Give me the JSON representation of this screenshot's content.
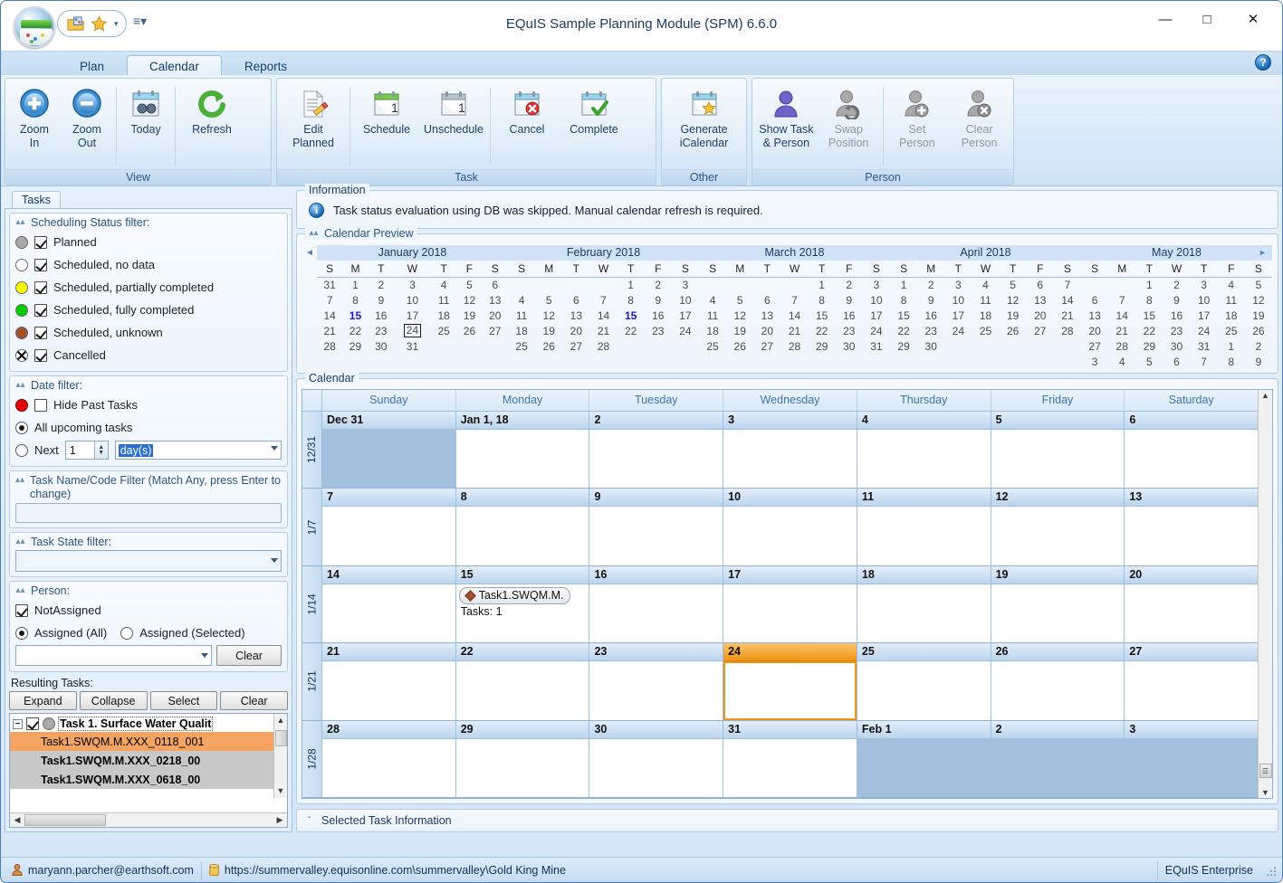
{
  "window": {
    "title": "EQuIS Sample Planning Module (SPM) 6.6.0",
    "minimize": "—",
    "maximize": "☐",
    "close": "✕",
    "qat_dropdown": "▾",
    "qat_overflow": "‰"
  },
  "ribbon": {
    "tabs": [
      {
        "label": "Plan",
        "active": false
      },
      {
        "label": "Calendar",
        "active": true
      },
      {
        "label": "Reports",
        "active": false
      }
    ],
    "help_label": "?",
    "groups": [
      {
        "name": "View",
        "label": "View",
        "buttons": [
          {
            "label": "Zoom\nIn",
            "line1": "Zoom",
            "line2": "In",
            "icon": "zoom-in-icon",
            "disabled": false
          },
          {
            "label": "Zoom Out",
            "line1": "Zoom",
            "line2": "Out",
            "icon": "zoom-out-icon",
            "disabled": false
          },
          {
            "label": "Today",
            "line1": "Today",
            "line2": "",
            "icon": "today-icon",
            "disabled": false
          },
          {
            "label": "Refresh",
            "line1": "Refresh",
            "line2": "",
            "icon": "refresh-icon",
            "disabled": false
          }
        ]
      },
      {
        "name": "Task",
        "label": "Task",
        "buttons": [
          {
            "line1": "Edit",
            "line2": "Planned",
            "icon": "edit-planned-icon",
            "disabled": false
          },
          {
            "line1": "Schedule",
            "line2": "",
            "icon": "schedule-icon",
            "disabled": false
          },
          {
            "line1": "Unschedule",
            "line2": "",
            "icon": "unschedule-icon",
            "disabled": false
          },
          {
            "line1": "Cancel",
            "line2": "",
            "icon": "cancel-icon",
            "disabled": false
          },
          {
            "line1": "Complete",
            "line2": "",
            "icon": "complete-icon",
            "disabled": false
          }
        ]
      },
      {
        "name": "Other",
        "label": "Other",
        "buttons": [
          {
            "line1": "Generate",
            "line2": "iCalendar",
            "icon": "generate-icalendar-icon",
            "disabled": false
          }
        ]
      },
      {
        "name": "Person",
        "label": "Person",
        "buttons": [
          {
            "line1": "Show Task",
            "line2": "& Person",
            "icon": "show-task-person-icon",
            "disabled": false
          },
          {
            "line1": "Swap",
            "line2": "Position",
            "icon": "swap-position-icon",
            "disabled": true
          },
          {
            "line1": "Set",
            "line2": "Person",
            "icon": "set-person-icon",
            "disabled": true
          },
          {
            "line1": "Clear",
            "line2": "Person",
            "icon": "clear-person-icon",
            "disabled": true
          }
        ]
      }
    ]
  },
  "left": {
    "tab_label": "Tasks",
    "scheduling_status": {
      "title": "Scheduling Status filter:",
      "items": [
        {
          "label": "Planned",
          "color": "#a9a9a9",
          "checked": true
        },
        {
          "label": "Scheduled, no data",
          "color": "#ffffff",
          "checked": true
        },
        {
          "label": "Scheduled, partially completed",
          "color": "#ffff00",
          "checked": true
        },
        {
          "label": "Scheduled, fully completed",
          "color": "#00cc00",
          "checked": true
        },
        {
          "label": "Scheduled, unknown",
          "color": "#a0522d",
          "checked": true
        },
        {
          "label": "Cancelled",
          "color": "#ffffff",
          "checked": true,
          "marker": "x"
        }
      ]
    },
    "date_filter": {
      "title": "Date filter:",
      "hide_past_label": "Hide Past Tasks",
      "hide_past_checked": false,
      "hide_past_color": "#e00000",
      "all_upcoming_label": "All upcoming tasks",
      "all_upcoming_selected": true,
      "next_label": "Next",
      "next_selected": false,
      "next_value": "1",
      "next_unit": "day(s)"
    },
    "name_filter": {
      "title": "Task Name/Code Filter (Match Any, press Enter to change)",
      "value": "",
      "placeholder": ""
    },
    "state_filter": {
      "title": "Task State filter:",
      "value": ""
    },
    "person": {
      "title": "Person:",
      "not_assigned_label": "NotAssigned",
      "not_assigned_checked": true,
      "assigned_all_label": "Assigned (All)",
      "assigned_all_selected": true,
      "assigned_selected_label": "Assigned (Selected)",
      "assigned_selected_selected": false,
      "combo_value": "",
      "clear_label": "Clear"
    },
    "results": {
      "title": "Resulting Tasks:",
      "buttons": [
        "Expand",
        "Collapse",
        "Select",
        "Clear"
      ],
      "root": {
        "label": "Task 1. Surface Water Qualit",
        "expander": "−",
        "checked": true,
        "color": "#a9a9a9"
      },
      "children": [
        {
          "label": "Task1.SWQM.M.XXX_0118_001",
          "state": "selected"
        },
        {
          "label": "Task1.SWQM.M.XXX_0218_00",
          "state": "grey"
        },
        {
          "label": "Task1.SWQM.M.XXX_0618_00",
          "state": "grey"
        }
      ]
    }
  },
  "information": {
    "legend": "Information",
    "message": "Task status evaluation using DB was skipped.  Manual calendar refresh is required."
  },
  "calendar_preview": {
    "legend": "Calendar Preview",
    "prev_arrow": "◄",
    "next_arrow": "►",
    "weekday_initials": [
      "S",
      "M",
      "T",
      "W",
      "T",
      "F",
      "S"
    ],
    "months": [
      {
        "title": "January 2018",
        "weeks": [
          [
            "31",
            "1",
            "2",
            "3",
            "4",
            "5",
            "6"
          ],
          [
            "7",
            "8",
            "9",
            "10",
            "11",
            "12",
            "13"
          ],
          [
            "14",
            "15",
            "16",
            "17",
            "18",
            "19",
            "20"
          ],
          [
            "21",
            "22",
            "23",
            "24",
            "25",
            "26",
            "27"
          ],
          [
            "28",
            "29",
            "30",
            "31",
            "",
            "",
            ""
          ],
          [
            "",
            "",
            "",
            "",
            "",
            "",
            ""
          ]
        ],
        "blue": [
          "15"
        ],
        "boxed": [
          "24"
        ]
      },
      {
        "title": "February 2018",
        "weeks": [
          [
            "",
            "",
            "",
            "",
            "1",
            "2",
            "3"
          ],
          [
            "4",
            "5",
            "6",
            "7",
            "8",
            "9",
            "10"
          ],
          [
            "11",
            "12",
            "13",
            "14",
            "15",
            "16",
            "17"
          ],
          [
            "18",
            "19",
            "20",
            "21",
            "22",
            "23",
            "24"
          ],
          [
            "25",
            "26",
            "27",
            "28",
            "",
            "",
            ""
          ],
          [
            "",
            "",
            "",
            "",
            "",
            "",
            ""
          ]
        ],
        "blue": [
          "15"
        ],
        "boxed": []
      },
      {
        "title": "March 2018",
        "weeks": [
          [
            "",
            "",
            "",
            "",
            "1",
            "2",
            "3"
          ],
          [
            "4",
            "5",
            "6",
            "7",
            "8",
            "9",
            "10"
          ],
          [
            "11",
            "12",
            "13",
            "14",
            "15",
            "16",
            "17"
          ],
          [
            "18",
            "19",
            "20",
            "21",
            "22",
            "23",
            "24"
          ],
          [
            "25",
            "26",
            "27",
            "28",
            "29",
            "30",
            "31"
          ],
          [
            "",
            "",
            "",
            "",
            "",
            "",
            ""
          ]
        ],
        "blue": [],
        "boxed": []
      },
      {
        "title": "April 2018",
        "weeks": [
          [
            "1",
            "2",
            "3",
            "4",
            "5",
            "6",
            "7"
          ],
          [
            "8",
            "9",
            "10",
            "11",
            "12",
            "13",
            "14"
          ],
          [
            "15",
            "16",
            "17",
            "18",
            "19",
            "20",
            "21"
          ],
          [
            "22",
            "23",
            "24",
            "25",
            "26",
            "27",
            "28"
          ],
          [
            "29",
            "30",
            "",
            "",
            "",
            "",
            ""
          ],
          [
            "",
            "",
            "",
            "",
            "",
            "",
            ""
          ]
        ],
        "blue": [],
        "boxed": []
      },
      {
        "title": "May 2018",
        "weeks": [
          [
            "",
            "",
            "1",
            "2",
            "3",
            "4",
            "5"
          ],
          [
            "6",
            "7",
            "8",
            "9",
            "10",
            "11",
            "12"
          ],
          [
            "13",
            "14",
            "15",
            "16",
            "17",
            "18",
            "19"
          ],
          [
            "20",
            "21",
            "22",
            "23",
            "24",
            "25",
            "26"
          ],
          [
            "27",
            "28",
            "29",
            "30",
            "31",
            "1",
            "2"
          ],
          [
            "3",
            "4",
            "5",
            "6",
            "7",
            "8",
            "9"
          ]
        ],
        "blue": [],
        "boxed": []
      }
    ]
  },
  "calendar": {
    "legend": "Calendar",
    "columns": [
      "Sunday",
      "Monday",
      "Tuesday",
      "Wednesday",
      "Thursday",
      "Friday",
      "Saturday"
    ],
    "scroll_up": "▲",
    "scroll_down": "▼",
    "weeks": [
      {
        "gutter": "12/31",
        "days": [
          {
            "num": "Dec 31",
            "other": true,
            "tasks": [],
            "count": "",
            "selected": false
          },
          {
            "num": "Jan 1, 18",
            "other": false,
            "tasks": [],
            "count": "",
            "selected": false
          },
          {
            "num": "2",
            "other": false,
            "tasks": [],
            "count": "",
            "selected": false
          },
          {
            "num": "3",
            "other": false,
            "tasks": [],
            "count": "",
            "selected": false
          },
          {
            "num": "4",
            "other": false,
            "tasks": [],
            "count": "",
            "selected": false
          },
          {
            "num": "5",
            "other": false,
            "tasks": [],
            "count": "",
            "selected": false
          },
          {
            "num": "6",
            "other": false,
            "tasks": [],
            "count": "",
            "selected": false
          }
        ]
      },
      {
        "gutter": "1/7",
        "days": [
          {
            "num": "7",
            "other": false,
            "tasks": [],
            "count": "",
            "selected": false
          },
          {
            "num": "8",
            "other": false,
            "tasks": [],
            "count": "",
            "selected": false
          },
          {
            "num": "9",
            "other": false,
            "tasks": [],
            "count": "",
            "selected": false
          },
          {
            "num": "10",
            "other": false,
            "tasks": [],
            "count": "",
            "selected": false
          },
          {
            "num": "11",
            "other": false,
            "tasks": [],
            "count": "",
            "selected": false
          },
          {
            "num": "12",
            "other": false,
            "tasks": [],
            "count": "",
            "selected": false
          },
          {
            "num": "13",
            "other": false,
            "tasks": [],
            "count": "",
            "selected": false
          }
        ]
      },
      {
        "gutter": "1/14",
        "days": [
          {
            "num": "14",
            "other": false,
            "tasks": [],
            "count": "",
            "selected": false
          },
          {
            "num": "15",
            "other": false,
            "tasks": [
              {
                "label": "Task1.SWQM.M.",
                "color": "#a0522d"
              }
            ],
            "count": "Tasks: 1",
            "selected": false
          },
          {
            "num": "16",
            "other": false,
            "tasks": [],
            "count": "",
            "selected": false
          },
          {
            "num": "17",
            "other": false,
            "tasks": [],
            "count": "",
            "selected": false
          },
          {
            "num": "18",
            "other": false,
            "tasks": [],
            "count": "",
            "selected": false
          },
          {
            "num": "19",
            "other": false,
            "tasks": [],
            "count": "",
            "selected": false
          },
          {
            "num": "20",
            "other": false,
            "tasks": [],
            "count": "",
            "selected": false
          }
        ]
      },
      {
        "gutter": "1/21",
        "days": [
          {
            "num": "21",
            "other": false,
            "tasks": [],
            "count": "",
            "selected": false
          },
          {
            "num": "22",
            "other": false,
            "tasks": [],
            "count": "",
            "selected": false
          },
          {
            "num": "23",
            "other": false,
            "tasks": [],
            "count": "",
            "selected": false
          },
          {
            "num": "24",
            "other": false,
            "tasks": [],
            "count": "",
            "selected": true
          },
          {
            "num": "25",
            "other": false,
            "tasks": [],
            "count": "",
            "selected": false
          },
          {
            "num": "26",
            "other": false,
            "tasks": [],
            "count": "",
            "selected": false
          },
          {
            "num": "27",
            "other": false,
            "tasks": [],
            "count": "",
            "selected": false
          }
        ]
      },
      {
        "gutter": "1/28",
        "days": [
          {
            "num": "28",
            "other": false,
            "tasks": [],
            "count": "",
            "selected": false
          },
          {
            "num": "29",
            "other": false,
            "tasks": [],
            "count": "",
            "selected": false
          },
          {
            "num": "30",
            "other": false,
            "tasks": [],
            "count": "",
            "selected": false
          },
          {
            "num": "31",
            "other": false,
            "tasks": [],
            "count": "",
            "selected": false
          },
          {
            "num": "Feb 1",
            "other": true,
            "tasks": [],
            "count": "",
            "selected": false
          },
          {
            "num": "2",
            "other": true,
            "tasks": [],
            "count": "",
            "selected": false
          },
          {
            "num": "3",
            "other": true,
            "tasks": [],
            "count": "",
            "selected": false
          }
        ]
      }
    ]
  },
  "selected_task_info": {
    "chevron": "ˇ",
    "label": "Selected Task Information"
  },
  "statusbar": {
    "user": "maryann.parcher@earthsoft.com",
    "connection": "https://summervalley.equisonline.com\\summervalley\\Gold King Mine",
    "enterprise": "EQuIS Enterprise"
  },
  "colors": {
    "accent_orange": "#ef9418",
    "selection_blue": "#2a6fd6",
    "titlebar_blue": "#1c3c63"
  }
}
